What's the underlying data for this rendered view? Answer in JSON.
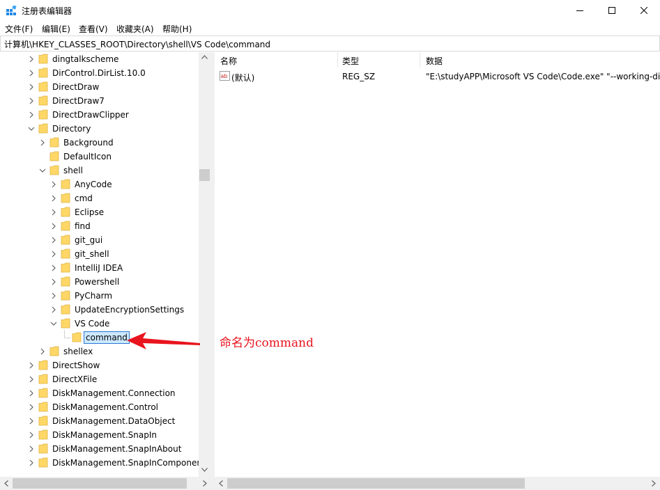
{
  "window": {
    "title": "注册表编辑器",
    "controls": {
      "minimize": "minimize-icon",
      "maximize": "maximize-icon",
      "close": "close-icon"
    }
  },
  "menu": [
    "文件(F)",
    "编辑(E)",
    "查看(V)",
    "收藏夹(A)",
    "帮助(H)"
  ],
  "address": "计算机\\HKEY_CLASSES_ROOT\\Directory\\shell\\VS Code\\command",
  "tree": [
    {
      "label": "dingtalkscheme",
      "level": 0,
      "state": "collapsed"
    },
    {
      "label": "DirControl.DirList.10.0",
      "level": 0,
      "state": "collapsed"
    },
    {
      "label": "DirectDraw",
      "level": 0,
      "state": "collapsed"
    },
    {
      "label": "DirectDraw7",
      "level": 0,
      "state": "collapsed"
    },
    {
      "label": "DirectDrawClipper",
      "level": 0,
      "state": "collapsed"
    },
    {
      "label": "Directory",
      "level": 0,
      "state": "expanded"
    },
    {
      "label": "Background",
      "level": 1,
      "state": "collapsed"
    },
    {
      "label": "DefaultIcon",
      "level": 1,
      "state": "none"
    },
    {
      "label": "shell",
      "level": 1,
      "state": "expanded"
    },
    {
      "label": "AnyCode",
      "level": 2,
      "state": "collapsed"
    },
    {
      "label": "cmd",
      "level": 2,
      "state": "collapsed"
    },
    {
      "label": "Eclipse",
      "level": 2,
      "state": "collapsed"
    },
    {
      "label": "find",
      "level": 2,
      "state": "collapsed"
    },
    {
      "label": "git_gui",
      "level": 2,
      "state": "collapsed"
    },
    {
      "label": "git_shell",
      "level": 2,
      "state": "collapsed"
    },
    {
      "label": "IntelliJ IDEA",
      "level": 2,
      "state": "collapsed"
    },
    {
      "label": "Powershell",
      "level": 2,
      "state": "collapsed"
    },
    {
      "label": "PyCharm",
      "level": 2,
      "state": "collapsed"
    },
    {
      "label": "UpdateEncryptionSettings",
      "level": 2,
      "state": "collapsed"
    },
    {
      "label": "VS Code",
      "level": 2,
      "state": "expanded"
    },
    {
      "label": "command",
      "level": 3,
      "state": "editing"
    },
    {
      "label": "shellex",
      "level": 1,
      "state": "collapsed"
    },
    {
      "label": "DirectShow",
      "level": 0,
      "state": "collapsed"
    },
    {
      "label": "DirectXFile",
      "level": 0,
      "state": "collapsed"
    },
    {
      "label": "DiskManagement.Connection",
      "level": 0,
      "state": "collapsed"
    },
    {
      "label": "DiskManagement.Control",
      "level": 0,
      "state": "collapsed"
    },
    {
      "label": "DiskManagement.DataObject",
      "level": 0,
      "state": "collapsed"
    },
    {
      "label": "DiskManagement.SnapIn",
      "level": 0,
      "state": "collapsed"
    },
    {
      "label": "DiskManagement.SnapInAbout",
      "level": 0,
      "state": "collapsed"
    },
    {
      "label": "DiskManagement.SnapInComponen",
      "level": 0,
      "state": "collapsed"
    }
  ],
  "list": {
    "columns": [
      "名称",
      "类型",
      "数据"
    ],
    "rows": [
      {
        "name": "(默认)",
        "type": "REG_SZ",
        "data": "\"E:\\studyAPP\\Microsoft VS Code\\Code.exe\" \"--working-di",
        "icon": "string-value-icon"
      }
    ]
  },
  "annotation": "命名为command",
  "colors": {
    "annotation": "#e8141e",
    "folder": "#ffd766",
    "folder_edge": "#dcb345",
    "selection": "#cce8ff"
  }
}
